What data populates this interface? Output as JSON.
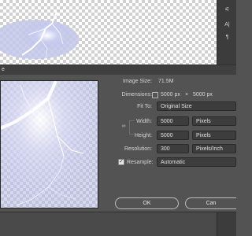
{
  "dialog": {
    "title_fragment": "e",
    "image_size": {
      "label": "Image Size:",
      "value": "71.5M"
    },
    "dimensions": {
      "label": "Dimensions:",
      "width": "5000 px",
      "separator": "×",
      "height": "5000 px"
    },
    "fit_to": {
      "label": "Fit To:",
      "value": "Original Size"
    },
    "width": {
      "label": "Width:",
      "value": "5000",
      "unit": "Pixels"
    },
    "height": {
      "label": "Height:",
      "value": "5000",
      "unit": "Pixels"
    },
    "resolution": {
      "label": "Resolution:",
      "value": "300",
      "unit": "Pixels/Inch"
    },
    "resample": {
      "label": "Resample:",
      "checked": true,
      "value": "Automatic"
    },
    "ok_label": "OK",
    "cancel_label": "Can"
  },
  "right_panel": {
    "icons": [
      "sliders-icon",
      "text-cursor-icon",
      "paragraph-icon"
    ],
    "glyphs": {
      "sliders": "⚟",
      "text": "A|",
      "paragraph": "¶"
    }
  },
  "colors": {
    "dialog_bg": "#535353",
    "field_bg": "#3d3d3d",
    "panel_bg": "#3c3c3c"
  }
}
